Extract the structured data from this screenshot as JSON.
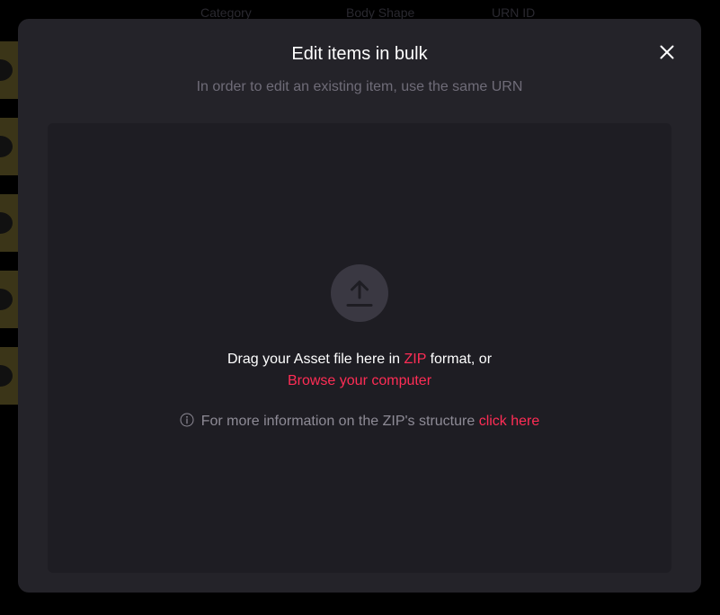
{
  "background": {
    "columns": [
      "Category",
      "Body Shape",
      "URN ID"
    ]
  },
  "modal": {
    "title": "Edit items in bulk",
    "subtitle": "In order to edit an existing item, use the same URN",
    "close_icon": "close-icon"
  },
  "dropzone": {
    "upload_icon": "upload-icon",
    "drag_prefix": "Drag your Asset file here in ",
    "drag_format": "ZIP",
    "drag_suffix": " format, or",
    "browse_label": "Browse your computer",
    "info_icon": "info-icon",
    "info_text": "For more information on the ZIP's structure ",
    "info_link": "click here"
  },
  "colors": {
    "accent": "#ff2d55",
    "modal_bg": "#242329",
    "dropzone_bg": "#1e1d23"
  }
}
